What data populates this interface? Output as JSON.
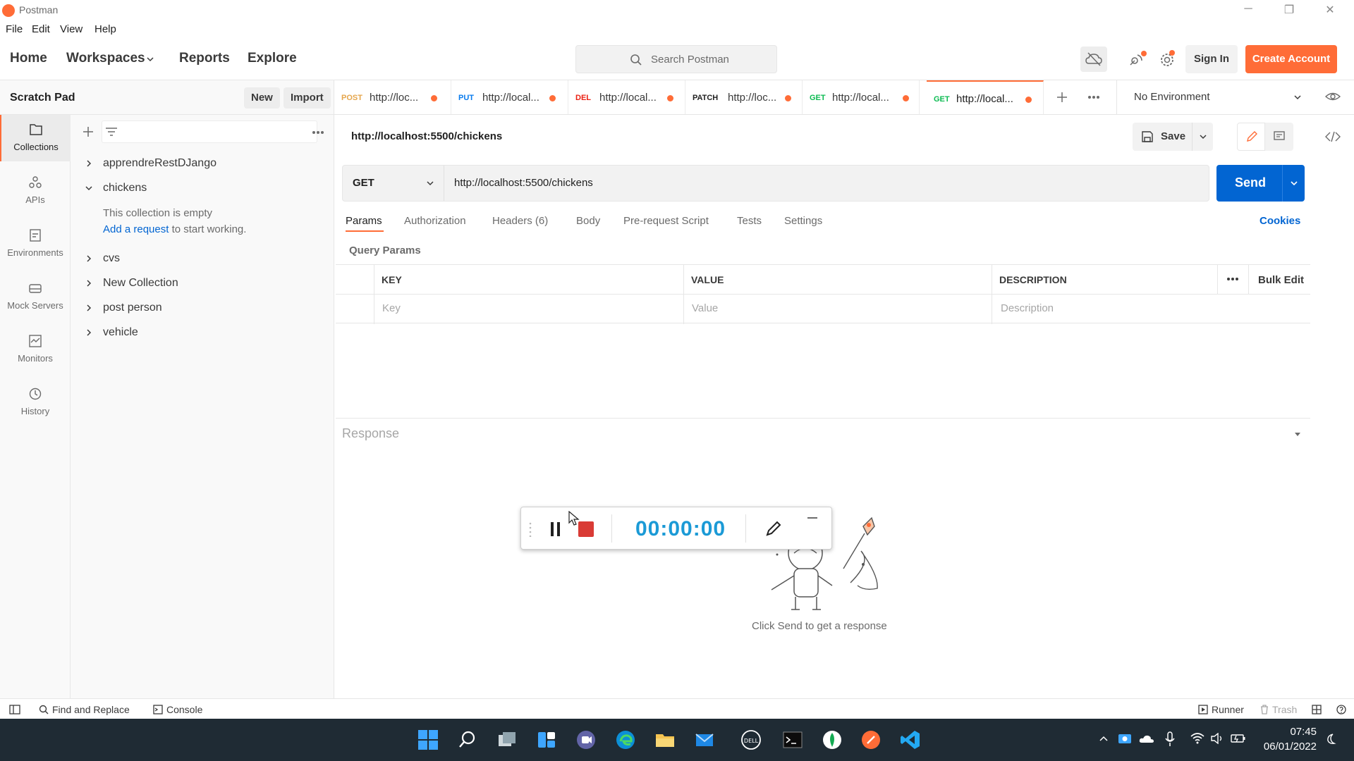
{
  "window": {
    "title": "Postman"
  },
  "menu": [
    "File",
    "Edit",
    "View",
    "Help"
  ],
  "header": {
    "nav": [
      "Home",
      "Workspaces",
      "Reports",
      "Explore"
    ],
    "search_placeholder": "Search Postman",
    "sign_in": "Sign In",
    "create_account": "Create Account"
  },
  "sidebar": {
    "title": "Scratch Pad",
    "new_label": "New",
    "import_label": "Import",
    "rail": [
      "Collections",
      "APIs",
      "Environments",
      "Mock Servers",
      "Monitors",
      "History"
    ],
    "collections": [
      "apprendreRestDJango",
      "chickens",
      "cvs",
      "New Collection",
      "post person",
      "vehicle"
    ],
    "empty_text": "This collection is empty",
    "add_request_link": "Add a request",
    "add_request_suffix": " to start working."
  },
  "tabs": [
    {
      "method": "POST",
      "url": "http://loc...",
      "color": "#e5a54b"
    },
    {
      "method": "PUT",
      "url": "http://local...",
      "color": "#097bed"
    },
    {
      "method": "DEL",
      "url": "http://local...",
      "color": "#eb2013"
    },
    {
      "method": "PATCH",
      "url": "http://loc...",
      "color": "#212121"
    },
    {
      "method": "GET",
      "url": "http://local...",
      "color": "#0cbb52"
    },
    {
      "method": "GET",
      "url": "http://local...",
      "color": "#0cbb52"
    }
  ],
  "environment": "No Environment",
  "request": {
    "name": "http://localhost:5500/chickens",
    "save_label": "Save",
    "method": "GET",
    "url": "http://localhost:5500/chickens",
    "send_label": "Send",
    "subtabs": [
      "Params",
      "Authorization",
      "Headers (6)",
      "Body",
      "Pre-request Script",
      "Tests",
      "Settings"
    ],
    "cookies": "Cookies",
    "query_params_label": "Query Params",
    "table": {
      "headers": [
        "KEY",
        "VALUE",
        "DESCRIPTION"
      ],
      "placeholders": [
        "Key",
        "Value",
        "Description"
      ],
      "bulk_edit": "Bulk Edit"
    }
  },
  "response": {
    "title": "Response",
    "hint": "Click Send to get a response"
  },
  "recorder": {
    "timer": "00:00:00"
  },
  "footer": {
    "find_replace": "Find and Replace",
    "console": "Console",
    "runner": "Runner",
    "trash": "Trash"
  },
  "taskbar": {
    "time": "07:45",
    "date": "06/01/2022"
  },
  "colors": {
    "accent": "#ff6c37",
    "primary": "#0265d2"
  }
}
